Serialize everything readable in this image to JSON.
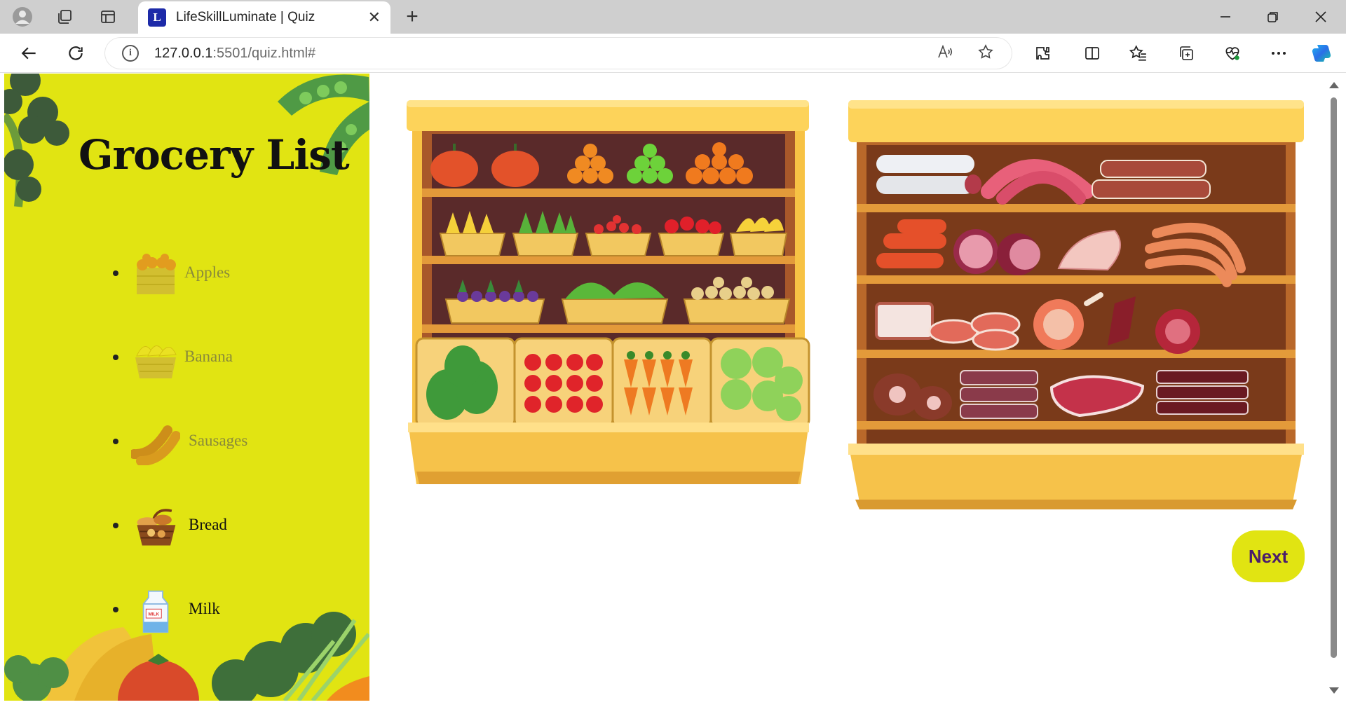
{
  "browser": {
    "tab": {
      "title": "LifeSkillLuminate | Quiz",
      "favicon": "L"
    },
    "address": {
      "host": "127.0.0.1",
      "rest": ":5501/quiz.html#"
    }
  },
  "sidebar": {
    "title": "Grocery List",
    "items": [
      {
        "label": "Apples",
        "icon": "apples-crate-icon",
        "state": "pending"
      },
      {
        "label": "Banana",
        "icon": "banana-basket-icon",
        "state": "pending"
      },
      {
        "label": "Sausages",
        "icon": "sausages-icon",
        "state": "pending"
      },
      {
        "label": "Bread",
        "icon": "bread-basket-icon",
        "state": "done"
      },
      {
        "label": "Milk",
        "icon": "milk-carton-icon",
        "state": "done"
      }
    ]
  },
  "main": {
    "shelves": [
      {
        "name": "produce-shelf",
        "type": "fruits-and-vegetables"
      },
      {
        "name": "meat-shelf",
        "type": "meats"
      }
    ],
    "next_label": "Next"
  },
  "colors": {
    "sidebar_bg": "#e1e412",
    "next_text": "#4a1c6b",
    "shelf_wood": "#a45a2a",
    "shelf_yellow": "#fbd24a"
  }
}
